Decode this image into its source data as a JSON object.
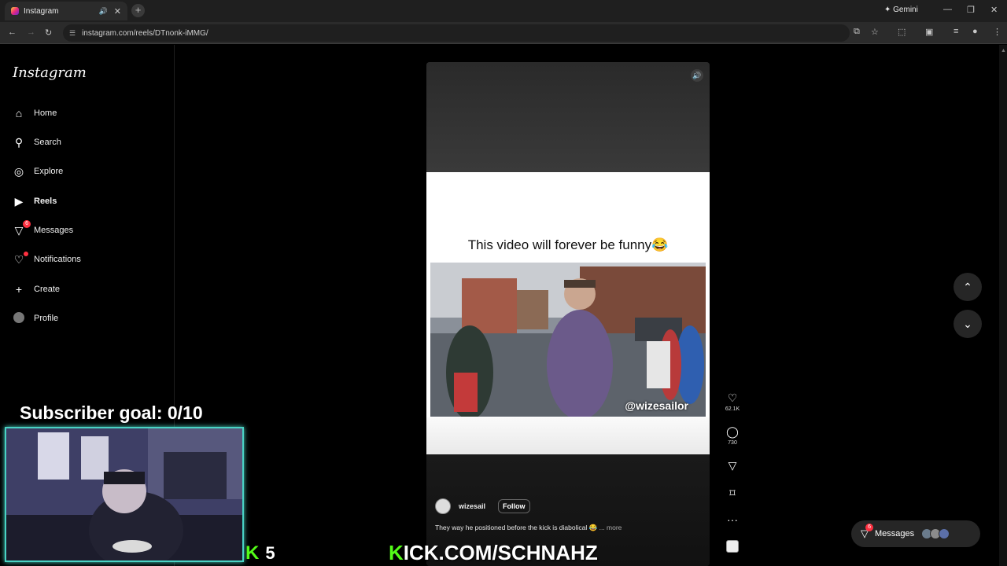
{
  "browser": {
    "tab_title": "Instagram",
    "tab_audio_icon": "speaker-icon",
    "tab_close": "✕",
    "new_tab": "+",
    "gemini": "✦ Gemini",
    "url": "instagram.com/reels/DTnonk-iMMG/",
    "window_controls": [
      "—",
      "❐",
      "✕"
    ]
  },
  "sidebar": {
    "logo": "Instagram",
    "items": [
      {
        "label": "Home",
        "icon": "home-icon"
      },
      {
        "label": "Search",
        "icon": "search-icon"
      },
      {
        "label": "Explore",
        "icon": "compass-icon"
      },
      {
        "label": "Reels",
        "icon": "reels-icon"
      },
      {
        "label": "Messages",
        "icon": "messenger-icon",
        "badge": "6"
      },
      {
        "label": "Notifications",
        "icon": "heart-icon"
      },
      {
        "label": "Create",
        "icon": "plus-icon"
      },
      {
        "label": "Profile",
        "icon": "avatar-icon"
      }
    ]
  },
  "reel": {
    "overlay_text": "This video will forever be funny😂",
    "watermark": "@wizesailor",
    "author": "wizesail",
    "follow_label": "Follow",
    "description": "They way he positioned before the kick is diabolical 😂",
    "more_label": "... more",
    "likes": "62.1K",
    "comments": "730"
  },
  "messages_pill": {
    "label": "Messages",
    "badge": "6"
  },
  "overlay": {
    "subscriber_goal": "Subscriber goal: 0/10",
    "kick_count": "5",
    "kick_url_k": "K",
    "kick_url_rest": "ICK.COM/SCHNAHZ"
  },
  "colors": {
    "accent_red": "#ff3040",
    "kick_green": "#53fc18",
    "webcam_border": "#49d3c4"
  }
}
